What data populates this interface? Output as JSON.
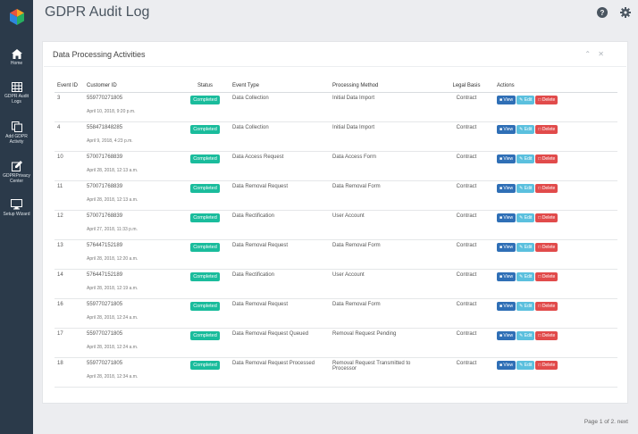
{
  "app": {
    "title": "GDPR Audit Log"
  },
  "sidebar": {
    "items": [
      {
        "label": "Home",
        "icon": "home-icon"
      },
      {
        "label": "GDPR Audit Logs",
        "icon": "table-icon"
      },
      {
        "label": "Add GDPR Activity",
        "icon": "copy-icon"
      },
      {
        "label": "GDPRPrivacy Center",
        "icon": "edit-icon"
      },
      {
        "label": "Setup Wizard",
        "icon": "monitor-icon"
      }
    ]
  },
  "panel": {
    "title": "Data Processing Activities",
    "headers": [
      "Event ID",
      "Customer ID",
      "Status",
      "Event Type",
      "Processing Method",
      "Legal Basis",
      "Actions"
    ]
  },
  "actions": {
    "view": "View",
    "edit": "Edit",
    "delete": "Delete"
  },
  "rows": [
    {
      "id": "3",
      "customer": "559770271805",
      "date": "April 10, 2018, 9:20 p.m.",
      "status": "Completed",
      "event": "Data Collection",
      "method": "Initial Data Import",
      "basis": "Contract"
    },
    {
      "id": "4",
      "customer": "558471848285",
      "date": "April 9, 2018, 4:23 p.m.",
      "status": "Completed",
      "event": "Data Collection",
      "method": "Initial Data Import",
      "basis": "Contract"
    },
    {
      "id": "10",
      "customer": "570071768839",
      "date": "April 28, 2018, 12:13 a.m.",
      "status": "Completed",
      "event": "Data Access Request",
      "method": "Data Access Form",
      "basis": "Contract"
    },
    {
      "id": "11",
      "customer": "570071768839",
      "date": "April 28, 2018, 12:13 a.m.",
      "status": "Completed",
      "event": "Data Removal Request",
      "method": "Data Removal Form",
      "basis": "Contract"
    },
    {
      "id": "12",
      "customer": "570071768839",
      "date": "April 27, 2018, 11:33 p.m.",
      "status": "Completed",
      "event": "Data Rectification",
      "method": "User Account",
      "basis": "Contract"
    },
    {
      "id": "13",
      "customer": "576447152189",
      "date": "April 28, 2018, 12:20 a.m.",
      "status": "Completed",
      "event": "Data Removal Request",
      "method": "Data Removal Form",
      "basis": "Contract"
    },
    {
      "id": "14",
      "customer": "576447152189",
      "date": "April 28, 2018, 12:19 a.m.",
      "status": "Completed",
      "event": "Data Rectification",
      "method": "User Account",
      "basis": "Contract"
    },
    {
      "id": "16",
      "customer": "559770271805",
      "date": "April 28, 2018, 12:24 a.m.",
      "status": "Completed",
      "event": "Data Removal Request",
      "method": "Data Removal Form",
      "basis": "Contract"
    },
    {
      "id": "17",
      "customer": "559770271805",
      "date": "April 28, 2018, 12:24 a.m.",
      "status": "Completed",
      "event": "Data Removal Request Queued",
      "method": "Removal Request Pending",
      "basis": "Contract"
    },
    {
      "id": "18",
      "customer": "559770271805",
      "date": "April 28, 2018, 12:34 a.m.",
      "status": "Completed",
      "event": "Data Removal Request Processed",
      "method": "Removal Request Transmitted to Processor",
      "basis": "Contract"
    }
  ],
  "pagination": {
    "text": "Page 1 of 2. next"
  }
}
